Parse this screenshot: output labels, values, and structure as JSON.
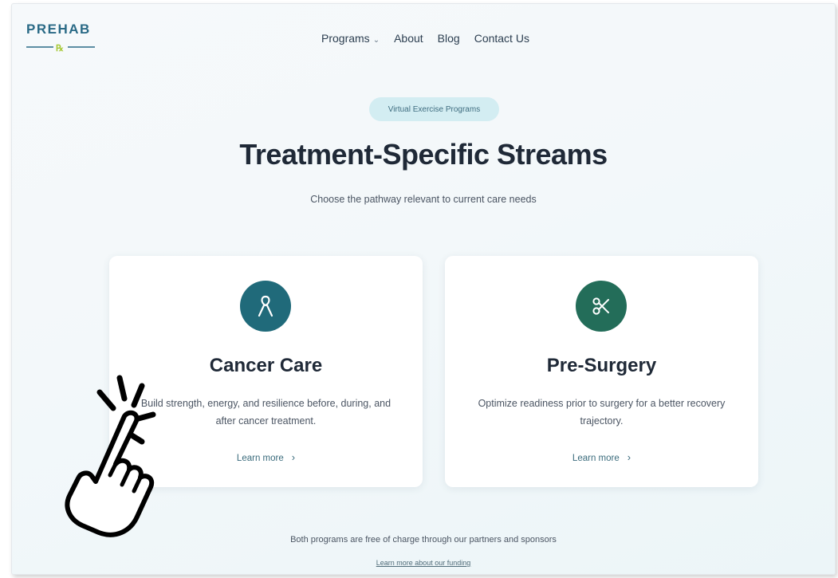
{
  "header": {
    "logo_text": "PREHAB",
    "nav": {
      "programs": "Programs",
      "about": "About",
      "blog": "Blog",
      "contact": "Contact Us"
    }
  },
  "hero": {
    "badge": "Virtual Exercise Programs",
    "title": "Treatment-Specific Streams",
    "subtitle": "Choose the pathway relevant to current care needs"
  },
  "cards": [
    {
      "icon": "ribbon-icon",
      "title": "Cancer Care",
      "description": "Build strength, energy, and resilience before, during, and after cancer treatment.",
      "link": "Learn more"
    },
    {
      "icon": "scissors-icon",
      "title": "Pre-Surgery",
      "description": "Optimize readiness prior to surgery for a better recovery trajectory.",
      "link": "Learn more"
    }
  ],
  "footer": {
    "note": "Both programs are free of charge through our partners and sponsors",
    "funding_link": "Learn more about our funding"
  },
  "colors": {
    "accent_teal": "#206a7a",
    "accent_green": "#236d59",
    "badge_bg": "#d3edf2",
    "logo_green": "#a5c832"
  }
}
